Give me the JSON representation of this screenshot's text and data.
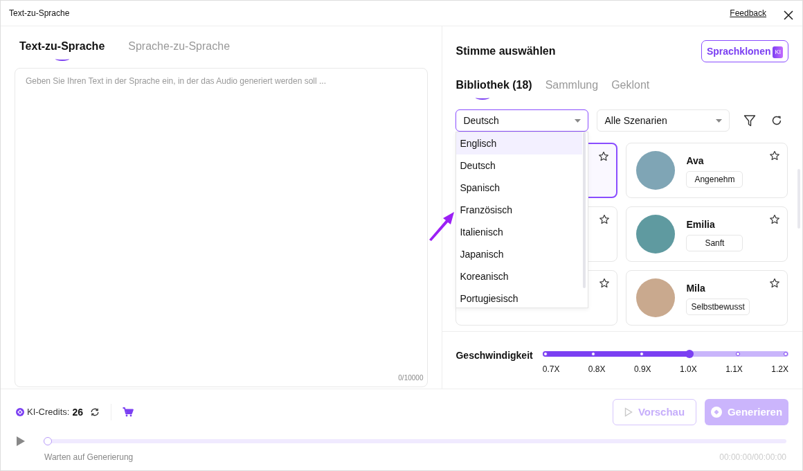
{
  "window": {
    "title": "Text-zu-Sprache",
    "feedback": "Feedback"
  },
  "mode_tabs": [
    {
      "label": "Text-zu-Sprache",
      "selected": true
    },
    {
      "label": "Sprache-zu-Sprache",
      "selected": false
    }
  ],
  "text_input": {
    "placeholder": "Geben Sie Ihren Text in der Sprache ein, in der das Audio generiert werden soll ...",
    "counter": "0/10000"
  },
  "voice_panel": {
    "title": "Stimme auswählen",
    "clone_button": "Sprachklonen",
    "clone_badge": "KI",
    "tabs": [
      {
        "label": "Bibliothek (18)",
        "selected": true
      },
      {
        "label": "Sammlung",
        "selected": false
      },
      {
        "label": "Geklont",
        "selected": false
      }
    ],
    "language_select": {
      "value": "Deutsch",
      "expanded": true,
      "options": [
        {
          "label": "Englisch",
          "highlighted": true
        },
        {
          "label": "Deutsch",
          "highlighted": false
        },
        {
          "label": "Spanisch",
          "highlighted": false
        },
        {
          "label": "Französisch",
          "highlighted": false
        },
        {
          "label": "Italienisch",
          "highlighted": false
        },
        {
          "label": "Japanisch",
          "highlighted": false
        },
        {
          "label": "Koreanisch",
          "highlighted": false
        },
        {
          "label": "Portugiesisch",
          "highlighted": false
        }
      ]
    },
    "scenario_select": {
      "value": "Alle Szenarien"
    },
    "voices": [
      {
        "selected": true
      },
      {
        "name": "Ava",
        "tag": "Angenehm",
        "selected": false
      },
      {
        "selected": false
      },
      {
        "name": "Emilia",
        "tag": "Sanft",
        "selected": false
      },
      {
        "selected": false
      },
      {
        "name": "Mila",
        "tag": "Selbstbewusst",
        "selected": false
      }
    ],
    "speed": {
      "label": "Geschwindigkeit",
      "level": 0.6,
      "ticks": [
        "0.7X",
        "0.8X",
        "0.9X",
        "1.0X",
        "1.1X",
        "1.2X"
      ]
    }
  },
  "footer": {
    "credits_label": "KI-Credits:",
    "credits_value": "26",
    "preview_button": {
      "label": "Vorschau",
      "disabled": true
    },
    "generate_button": {
      "label": "Generieren",
      "disabled": true
    },
    "player": {
      "level": 0,
      "status": "Warten auf Generierung",
      "time": "00:00:00/00:00:00"
    }
  }
}
